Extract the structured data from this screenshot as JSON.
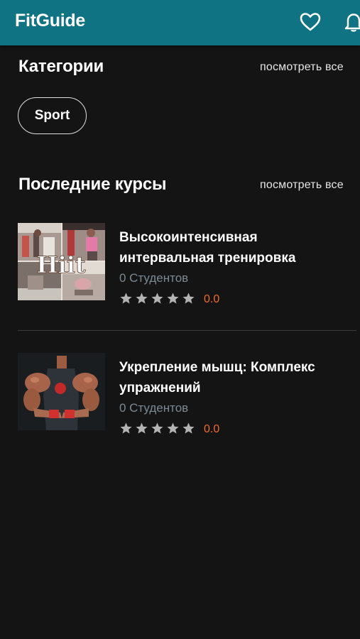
{
  "header": {
    "brand": "FitGuide",
    "background": "#0f7384",
    "icons": [
      "heart-icon",
      "bell-icon"
    ]
  },
  "categories": {
    "title": "Категории",
    "see_all": "посмотреть все",
    "items": [
      {
        "label": "Sport"
      }
    ]
  },
  "latest": {
    "title": "Последние курсы",
    "see_all": "посмотреть все",
    "courses": [
      {
        "title": "Высокоинтенсивная интервальная тренировка",
        "thumb_text": "Hiit",
        "students": "0 Студентов",
        "rating": "0.0",
        "stars": 5
      },
      {
        "title": "Укрепление мышц: Комплекс упражнений",
        "students": "0 Студентов",
        "rating": "0.0",
        "stars": 5
      }
    ]
  },
  "colors": {
    "background": "#141414",
    "accent": "#0f7384",
    "rating": "#f06a2a",
    "muted": "#7c8a93",
    "star": "#b3b3b3"
  }
}
